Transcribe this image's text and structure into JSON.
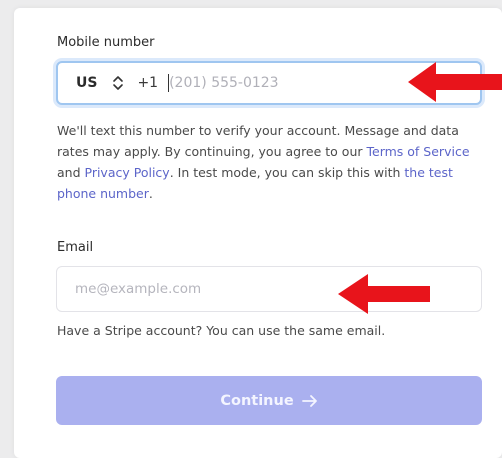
{
  "phone": {
    "label": "Mobile number",
    "country_code": "US",
    "dial_code": "+1",
    "placeholder": "(201) 555-0123",
    "help_text_1": "We'll text this number to verify your account. Message and data rates may apply. By continuing, you agree to our ",
    "terms_link": "Terms of Service",
    "help_text_2": " and ",
    "privacy_link": "Privacy Policy",
    "help_text_3": ". In test mode, you can skip this with ",
    "test_phone_link": "the test phone number",
    "help_text_4": "."
  },
  "email": {
    "label": "Email",
    "placeholder": "me@example.com",
    "hint": "Have a Stripe account? You can use the same email."
  },
  "continue_button": {
    "label": "Continue",
    "arrow_icon": "arrow-right-icon"
  },
  "annotations": {
    "arrow_color": "#e8141b"
  },
  "colors": {
    "link": "#5c65c9",
    "button_disabled": "#aab0ef",
    "focus_border": "#9fc6f0"
  }
}
